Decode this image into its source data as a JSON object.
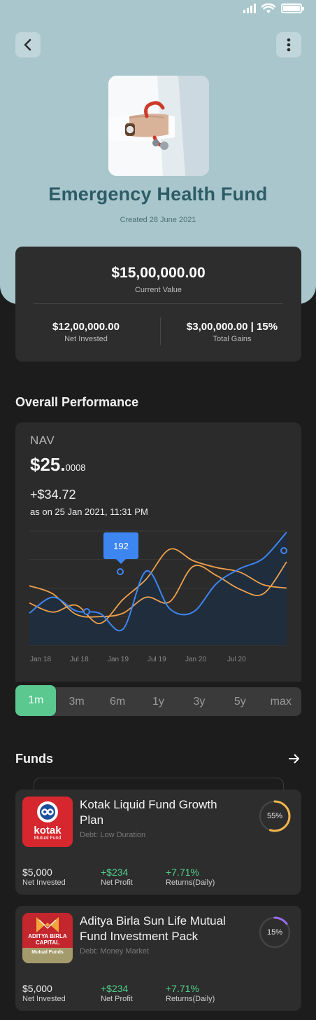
{
  "fund": {
    "title": "Emergency Health Fund",
    "created": "Created 28 June 2021"
  },
  "summary": {
    "current_value": "$15,00,000.00",
    "current_value_label": "Current Value",
    "net_invested": "$12,00,000.00",
    "net_invested_label": "Net Invested",
    "total_gains": "$3,00,000.00 | 15%",
    "total_gains_label": "Total Gains"
  },
  "performance": {
    "section_title": "Overall Performance",
    "nav_label": "NAV",
    "nav_main": "$25.",
    "nav_decimal": "0008",
    "change": "+$34.72",
    "as_of": "as on 25 Jan 2021, 11:31 PM",
    "ranges": [
      "1m",
      "3m",
      "6m",
      "1y",
      "3y",
      "5y",
      "max"
    ],
    "active_range": "1m"
  },
  "chart_data": {
    "type": "line",
    "x_tick_labels": [
      "Jan 18",
      "Jul 18",
      "Jan 19",
      "Jul 19",
      "Jan 20",
      "Jul 20"
    ],
    "tooltip": "192",
    "series": [
      {
        "color": "#3d86f2",
        "values": [
          0.28,
          0.42,
          0.3,
          0.28,
          0.14,
          0.65,
          0.32,
          0.29,
          0.54,
          0.67,
          0.76,
          0.99
        ]
      },
      {
        "color": "#f0a14c",
        "values": [
          0.52,
          0.45,
          0.27,
          0.25,
          0.28,
          0.42,
          0.38,
          0.69,
          0.61,
          0.49,
          0.45,
          0.73
        ]
      },
      {
        "color": "#f0a14c",
        "values": [
          0.37,
          0.29,
          0.35,
          0.19,
          0.4,
          0.58,
          0.84,
          0.74,
          0.68,
          0.64,
          0.53,
          0.5
        ]
      }
    ],
    "colors": {
      "area": "#1e2d3f",
      "highlight": "#3d86f2"
    }
  },
  "funds_section": {
    "title": "Funds",
    "items": [
      {
        "name": "Kotak Liquid Fund Growth Plan",
        "category": "Debt: Low Duration",
        "progress": 0.55,
        "progress_label": "55%",
        "ring_color": "#f3b64c",
        "logo_text": "kotak",
        "logo_sub": "Mutual Fund",
        "net_invested": "$5,000",
        "net_invested_label": "Net Invested",
        "net_profit": "+$234",
        "net_profit_label": "Net Profit",
        "returns": "+7.71%",
        "returns_label": "Returns(Daily)"
      },
      {
        "name": "Aditya Birla Sun Life Mutual Fund Investment Pack",
        "category": "Debt: Money Market",
        "progress": 0.15,
        "progress_label": "15%",
        "ring_color": "#9b6cf0",
        "logo_text": "ADITYA BIRLA CAPITAL",
        "logo_sub": "Mutual Funds",
        "net_invested": "$5,000",
        "net_invested_label": "Net Invested",
        "net_profit": "+$234",
        "net_profit_label": "Net Profit",
        "returns": "+7.71%",
        "returns_label": "Returns(Daily)"
      }
    ]
  }
}
